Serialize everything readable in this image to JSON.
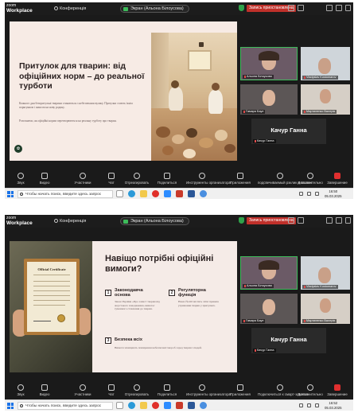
{
  "zoom": {
    "brand_top": "zoom",
    "brand_bottom": "Workplace",
    "conference": "Конференція",
    "screen_share": "Экран (Альона Білоусова)",
    "recording": "Запись приостановлена"
  },
  "toolbar": {
    "audio": "Звук",
    "video": "Видео",
    "participants": "Участники",
    "participants_count": "3",
    "chat": "Чат",
    "react": "Отреагировать",
    "share": "Поделиться",
    "host_tools": "Инструменты организатора",
    "apps": "Приложения",
    "notes": "Заметки",
    "smart_summary": "подсвечиваемый рзклик и пазвон",
    "smart_summary2": "Подключиться к смарт-заметка",
    "more": "Дополнительно",
    "end": "Завершение"
  },
  "taskbar": {
    "search": "Чтобы начать поиск, введите здесь запрос",
    "time1": "16:50",
    "date1": "05.03.2025",
    "time2": "16:52",
    "date2": "05.03.2025"
  },
  "participants": {
    "p1": "Альона Білоусова",
    "p2": "Vladyslav Kostomarov",
    "p3": "Гамара Бауе",
    "p4": "Мартиненко Валерія",
    "p5": "Качур Ганна",
    "big": "Качур Ганна"
  },
  "slide1": {
    "title": "Притулок для тварин: від офіційних норм – до реальної турботи",
    "p1": "Кожного дня безпритульні тварини стикаються з небезпеками вулиці. Притулки стають їхнім порятунком і шансом на нову родину.",
    "p2": "Розглянемо, як офіційні норми перетворюються на реальну турботу про тварин."
  },
  "slide2": {
    "title": "Навіщо потрібні офіційні вимоги?",
    "cert_title": "Official Certificate",
    "items": [
      {
        "num": "1",
        "head": "Законодавча основа",
        "text": "Закон України «Про захист тварин від жорстокого поводження» вимагає гуманного ставлення до тварин."
      },
      {
        "num": "2",
        "head": "Регуляторна функція",
        "text": "Наказ №416 містить чіткі правила утримання тварин у притулках."
      },
      {
        "num": "3",
        "head": "Безпека всіх",
        "text": "Вимоги захищають поширення небезпечної хвороб серед тварин і людей."
      }
    ]
  }
}
